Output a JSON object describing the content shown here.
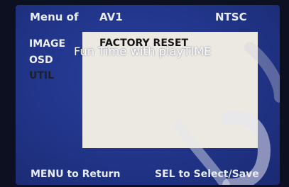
{
  "header": {
    "menu_title": "Menu of",
    "source": "AV1",
    "standard": "NTSC"
  },
  "menu": {
    "items": [
      {
        "label": "IMAGE"
      },
      {
        "label": "OSD"
      },
      {
        "label": "UTIL"
      }
    ]
  },
  "panel": {
    "title": "FACTORY RESET"
  },
  "overlay": {
    "text": "Fun Time with playTIME"
  },
  "footer": {
    "left": "MENU to Return",
    "right": "SEL to Select/Save"
  },
  "colors": {
    "screen_blue": "#22368c",
    "panel_bg": "#ece9e2",
    "text_light": "#e8ecf4"
  }
}
